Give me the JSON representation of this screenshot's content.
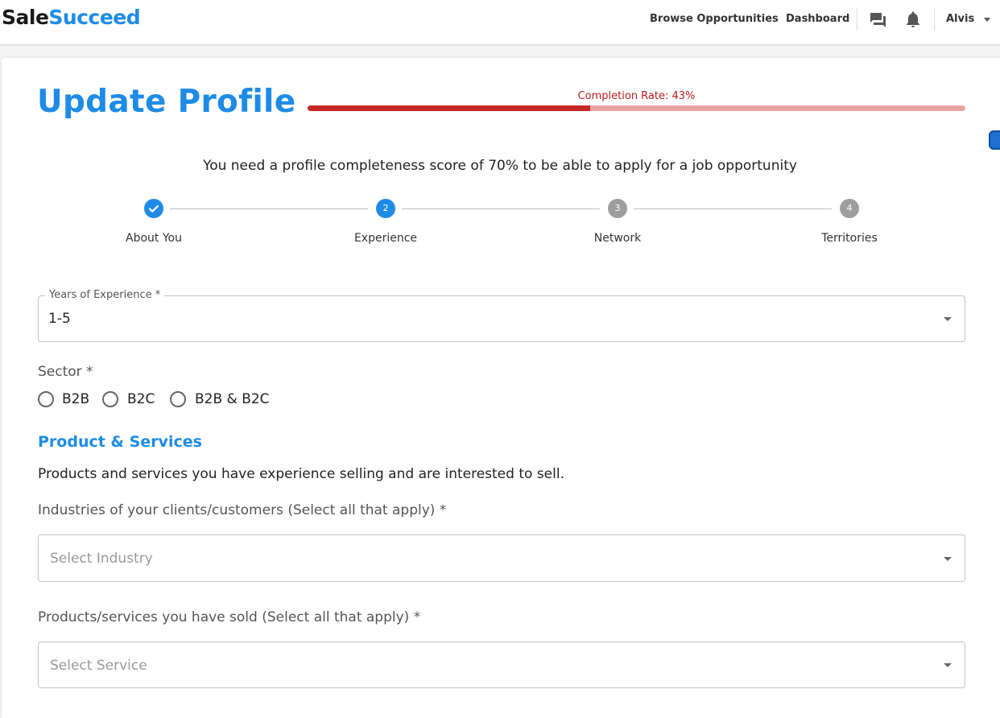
{
  "header": {
    "logo_part1": "Sale",
    "logo_part2": "Succeed",
    "nav": [
      "Browse Opportunities",
      "Dashboard"
    ],
    "icons": [
      "chat-icon",
      "bell-icon"
    ],
    "user_name": "Alvis"
  },
  "profile": {
    "title": "Update Profile",
    "completion_label": "Completion Rate: 43%",
    "completion_percent": 43,
    "notice": "You need a profile completeness score of 70% to be able to apply for a job opportunity"
  },
  "stepper": {
    "steps": [
      {
        "number": "1",
        "label": "About You",
        "state": "done"
      },
      {
        "number": "2",
        "label": "Experience",
        "state": "active"
      },
      {
        "number": "3",
        "label": "Network",
        "state": "todo"
      },
      {
        "number": "4",
        "label": "Territories",
        "state": "todo"
      }
    ]
  },
  "form": {
    "years_label": "Years of Experience *",
    "years_value": "1-5",
    "sector_label": "Sector *",
    "sector_options": [
      "B2B",
      "B2C",
      "B2B & B2C"
    ],
    "section_title": "Product & Services",
    "section_desc": "Products and services you have experience selling and are interested to sell.",
    "industries_label": "Industries of your clients/customers (Select all that apply) *",
    "industries_placeholder": "Select Industry",
    "products_label": "Products/services you have sold (Select all that apply) *",
    "products_placeholder": "Select Service"
  },
  "colors": {
    "brand": "#1e8be6",
    "progress": "#c62828",
    "progress_track": "#e8a4a4"
  }
}
